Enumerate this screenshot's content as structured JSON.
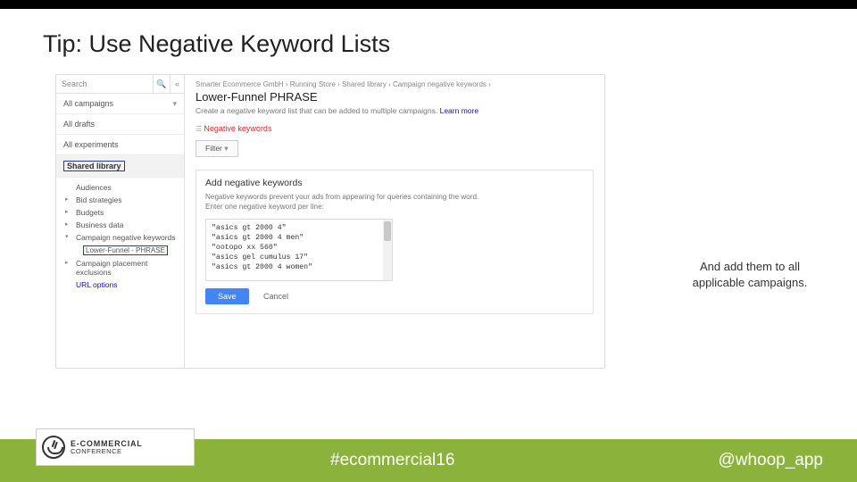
{
  "slide": {
    "title": "Tip: Use Negative Keyword Lists",
    "annotation_l1": "And add them to all",
    "annotation_l2": "applicable campaigns."
  },
  "screenshot": {
    "search": {
      "placeholder": "Search",
      "icon": "🔍",
      "chevron": "«"
    },
    "nav": {
      "all_campaigns": "All campaigns",
      "all_drafts": "All drafts",
      "all_experiments": "All experiments",
      "shared_library": "Shared library",
      "subs": {
        "audiences": "Audiences",
        "bid_strategies": "Bid strategies",
        "budgets": "Budgets",
        "business_data": "Business data",
        "campaign_neg": "Campaign negative keywords",
        "lower_funnel_box": "Lower-Funnel - PHRASE",
        "campaign_place": "Campaign placement exclusions",
        "url_options": "URL options"
      }
    },
    "main": {
      "breadcrumb": "Smarter Ecommerce GmbH › Running Store › Shared library › Campaign negative keywords ›",
      "heading": "Lower-Funnel PHRASE",
      "desc": "Create a negative keyword list that can be added to multiple campaigns.",
      "learn": "Learn more",
      "neg_kw": "Negative keywords",
      "filter": "Filter",
      "panel": {
        "title": "Add negative keywords",
        "line1": "Negative keywords prevent your ads from appearing for queries containing the word.",
        "line2": "Enter one negative keyword per line:",
        "kw1": "\"asics gt 2000 4\"",
        "kw2": "\"asics gt 2000 4 men\"",
        "kw3": "\"ootopo xx 560\"",
        "kw4": "\"asics gel cumulus 17\"",
        "kw5": "\"asics gt 2000 4 women\"",
        "save": "Save",
        "cancel": "Cancel"
      }
    }
  },
  "footer": {
    "logo_line1": "E-COMMERCIAL",
    "logo_line2": "CONFERENCE",
    "hashtag": "#ecommercial16",
    "handle": "@whoop_app"
  }
}
